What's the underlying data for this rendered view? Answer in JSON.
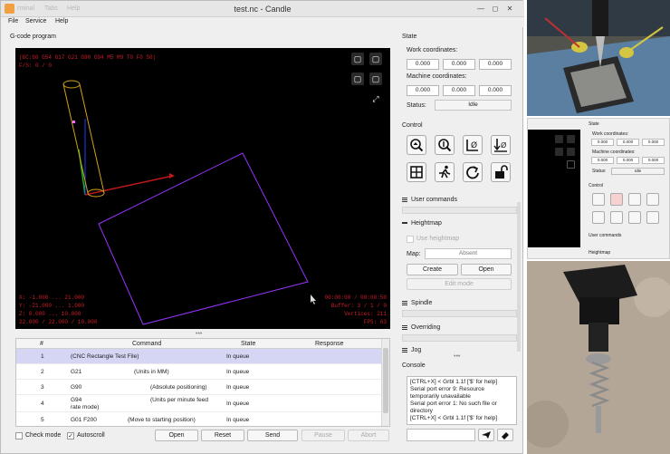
{
  "window": {
    "title": "test.nc - Candle",
    "ghost_menu": [
      "rminal",
      "Tabs",
      "Help"
    ]
  },
  "menu": [
    "File",
    "Service",
    "Help"
  ],
  "gcode": {
    "group_label": "G-code program",
    "overlay": {
      "parser_state": "(GC:G0 G54 G17 G21 G90 G94 M5 M9 T0 F0 S0)",
      "feed_speed": "F/S: 0 / 0",
      "range_x": "X: -1.000 ... 21.000",
      "range_y": "Y: -21.000 ... 1.000",
      "range_z": "Z: 0.000 ... 10.000",
      "lines": "22.000 / 22.000 / 10.000",
      "time": "00:00:00 / 00:00:50",
      "buffer": "Buffer: 3 / 1 / 0",
      "vertices": "Vertices: 211",
      "fps": "FPS: 63"
    },
    "table": {
      "headers": [
        "#",
        "Command",
        "State",
        "Response"
      ],
      "rows": [
        {
          "num": "1",
          "command": "(CNC Rectangle Test File)",
          "state": "In queue",
          "response": ""
        },
        {
          "num": "2",
          "command": "G21",
          "comment": "(Units in MM)",
          "state": "In queue",
          "response": ""
        },
        {
          "num": "3",
          "command": "G90",
          "comment": "(Absolute positioning)",
          "state": "In queue",
          "response": ""
        },
        {
          "num": "4",
          "command": "G94",
          "comment": "(Units per minute feed",
          "comment2": "rate mode)",
          "state": "In queue",
          "response": ""
        },
        {
          "num": "5",
          "command": "G01 F200",
          "comment": "(Move to starting position)",
          "state": "In queue",
          "response": ""
        }
      ]
    },
    "check_mode_label": "Check mode",
    "autoscroll_label": "Autoscroll",
    "buttons": {
      "open": "Open",
      "reset": "Reset",
      "send": "Send",
      "pause": "Pause",
      "abort": "Abort"
    }
  },
  "state": {
    "label": "State",
    "work_label": "Work coordinates:",
    "work": [
      "0.000",
      "0.000",
      "0.000"
    ],
    "machine_label": "Machine coordinates:",
    "machine": [
      "0.000",
      "0.000",
      "0.000"
    ],
    "status_label": "Status:",
    "status": "Idle"
  },
  "control": {
    "label": "Control"
  },
  "user_commands": {
    "label": "User commands"
  },
  "heightmap": {
    "label": "Heightmap",
    "use_label": "Use heightmap",
    "map_label": "Map:",
    "map_value": "Absent",
    "create": "Create",
    "open": "Open",
    "edit_mode": "Edit mode"
  },
  "spindle": {
    "label": "Spindle"
  },
  "overriding": {
    "label": "Overriding"
  },
  "jog": {
    "label": "Jog"
  },
  "console": {
    "label": "Console",
    "lines": [
      "[CTRL+X] < Grbl 1.1f ['$' for help]",
      "Serial port error 9: Resource",
      "temporarily unavailable",
      "Serial port error 1: No such file or",
      "directory",
      "[CTRL+X] < Grbl 1.1f ['$' for help]"
    ]
  },
  "thumb": {
    "state_label": "State",
    "work_label": "Work coordinates:",
    "work": [
      "0.000",
      "0.000",
      "0.000"
    ],
    "machine_label": "Machine coordinates:",
    "machine": [
      "0.000",
      "0.000",
      "0.000"
    ],
    "status_label": "Status:",
    "status": "Idle",
    "control_label": "Control",
    "user_commands_label": "User commands",
    "heightmap_label": "Heightmap"
  },
  "colors": {
    "toolpath": "#9933ff",
    "overlay_text": "#c8202a",
    "selection": "#d5d5f4",
    "tool": "#d4a017"
  }
}
